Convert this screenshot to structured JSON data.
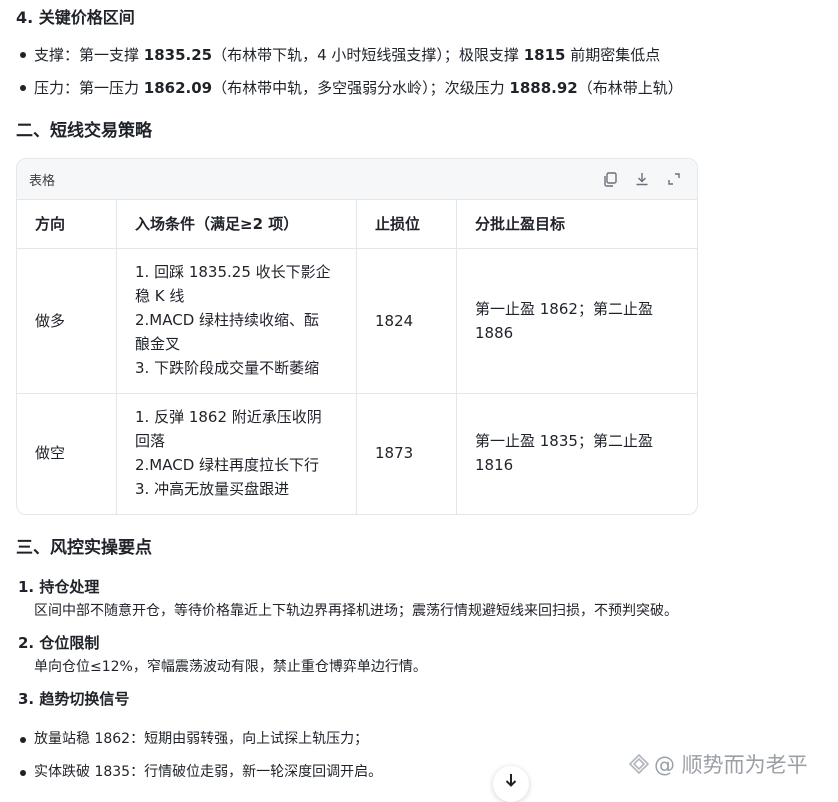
{
  "section4": {
    "title": "4. 关键价格区间",
    "support": {
      "pre": "支撑：第一支撑 ",
      "v1": "1835.25",
      "mid": "（布林带下轨，4 小时短线强支撑）；极限支撑 ",
      "v2": "1815",
      "post": " 前期密集低点"
    },
    "resistance": {
      "pre": "压力：第一压力 ",
      "v1": "1862.09",
      "mid": "（布林带中轨，多空强弱分水岭）；次级压力 ",
      "v2": "1888.92",
      "post": "（布林带上轨）"
    }
  },
  "section2_title": "二、短线交易策略",
  "table": {
    "label": "表格",
    "headers": [
      "方向",
      "入场条件（满足≥2 项）",
      "止损位",
      "分批止盈目标"
    ],
    "rows": [
      {
        "direction": "做多",
        "conditions": [
          "1. 回踩 1835.25 收长下影企",
          "稳 K 线",
          "2.MACD 绿柱持续收缩、酝",
          "酿金叉",
          "3. 下跌阶段成交量不断萎缩"
        ],
        "stop": "1824",
        "targets": [
          "第一止盈 1862；第二止盈",
          "1886"
        ]
      },
      {
        "direction": "做空",
        "conditions": [
          "1. 反弹 1862 附近承压收阴",
          "回落",
          "2.MACD 绿柱再度拉长下行",
          "3. 冲高无放量买盘跟进"
        ],
        "stop": "1873",
        "targets": [
          "第一止盈 1835；第二止盈",
          "1816"
        ]
      }
    ],
    "icons": [
      "copy-icon",
      "download-icon",
      "expand-icon"
    ]
  },
  "section3": {
    "title": "三、风控实操要点",
    "items": [
      {
        "title": "1. 持仓处理",
        "desc": "区间中部不随意开仓，等待价格靠近上下轨边界再择机进场；震荡行情规避短线来回扫损，不预判突破。"
      },
      {
        "title": "2. 仓位限制",
        "desc": "单向仓位≤12%，窄幅震荡波动有限，禁止重仓博弈单边行情。"
      },
      {
        "title": "3. 趋势切换信号",
        "desc": ""
      }
    ],
    "bullets": [
      "放量站稳 1862：短期由弱转强，向上试探上轨压力；",
      "实体跌破 1835：行情破位走弱，新一轮深度回调开启。"
    ]
  },
  "watermark": "@ 顺势而为老平"
}
